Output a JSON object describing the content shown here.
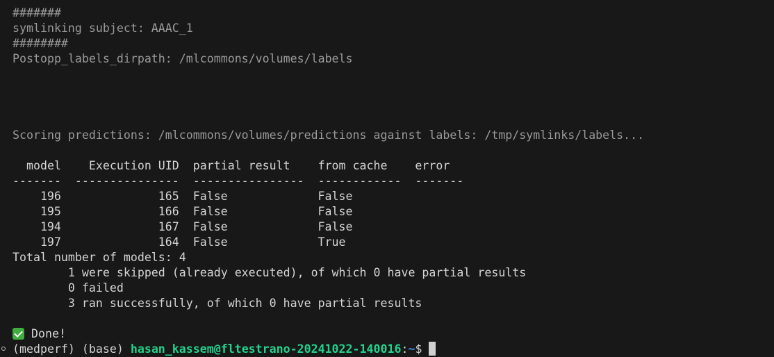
{
  "theme": {
    "background": "#181818",
    "dim_text": "#9a9a9a",
    "bright_text": "#d4d4d4",
    "user_host_color": "#23d18b",
    "path_color": "#3b8eea",
    "success_icon_color": "#3fae3f",
    "cursor_color": "#d0d0d0"
  },
  "log": {
    "line1": "#######",
    "line2": "symlinking subject: AAAC_1",
    "line3": "########",
    "line4": "Postopp_labels_dirpath: /mlcommons/volumes/labels",
    "scoring": "Scoring predictions: /mlcommons/volumes/predictions against labels: /tmp/symlinks/labels..."
  },
  "table": {
    "header": "  model    Execution UID  partial result    from cache    error",
    "separator": "-------  ---------------  ----------------  ------------  -------",
    "rows": [
      {
        "model": "196",
        "uid": "165",
        "partial": "False",
        "cache": "False",
        "error": ""
      },
      {
        "model": "195",
        "uid": "166",
        "partial": "False",
        "cache": "False",
        "error": ""
      },
      {
        "model": "194",
        "uid": "167",
        "partial": "False",
        "cache": "False",
        "error": ""
      },
      {
        "model": "197",
        "uid": "164",
        "partial": "False",
        "cache": "True",
        "error": ""
      }
    ]
  },
  "summary": {
    "total": "Total number of models: 4",
    "skipped": "        1 were skipped (already executed), of which 0 have partial results",
    "failed": "        0 failed",
    "succeeded": "        3 ran successfully, of which 0 have partial results"
  },
  "done": {
    "icon": "check-icon",
    "text": "Done!"
  },
  "prompt": {
    "env": "(medperf) (base) ",
    "user_host": "hasan_kassem@fltestrano-20241022-140016",
    "separator": ":",
    "path": "~",
    "symbol": "$"
  }
}
